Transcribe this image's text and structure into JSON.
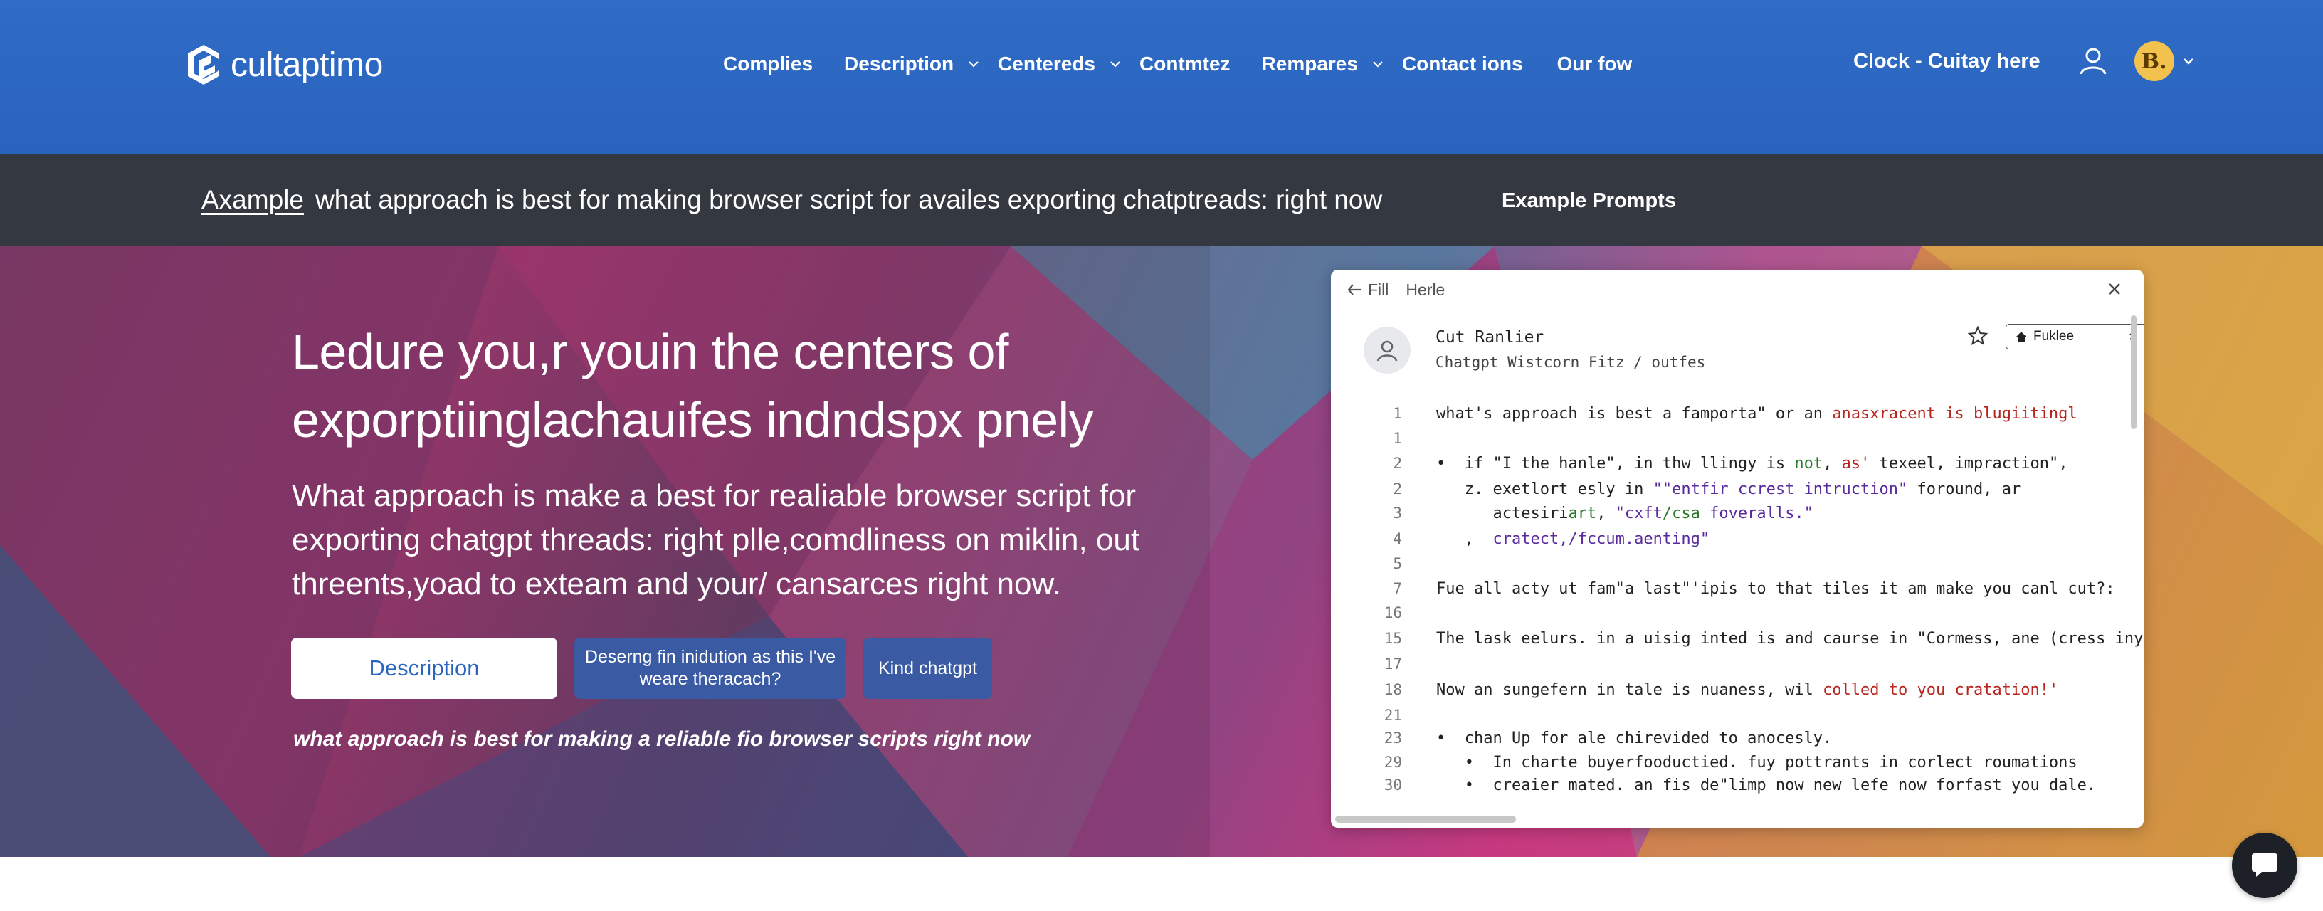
{
  "nav": {
    "logo_text": "cultaptimo",
    "links": [
      {
        "label": "Complies",
        "dropdown": false
      },
      {
        "label": "Description",
        "dropdown": true
      },
      {
        "label": "Centereds",
        "dropdown": true
      },
      {
        "label": "Contmtez",
        "dropdown": false
      },
      {
        "label": "Rempares",
        "dropdown": true
      },
      {
        "label": "Contact ions",
        "dropdown": false
      },
      {
        "label": "Our fow",
        "dropdown": false
      }
    ],
    "cta": "Clock - Cuitay  here",
    "avatar_letter": "B."
  },
  "banner": {
    "tag": "Axample",
    "text": "what approach is best for making browser script for availes exporting chatptreads: right now",
    "link": "Example Prompts"
  },
  "hero": {
    "title": "Ledure you,r youin the centers of exporptiinglachauifes indndspx pnely",
    "subtitle": "What approach is make a best for realiable browser script for exporting chatgpt threads: right plle,comdliness on miklin, out threents,yoad to exteam and your/ cansarces right now.",
    "btn_primary": "Description",
    "btn_secondary": "Deserng fin  inidution as this I've weare theracach?",
    "btn_tertiary": "Kind chatgpt",
    "note": "what approach is best for making a reliable fio browser scripts right now"
  },
  "panel": {
    "back_label": "Fill",
    "tab_label": "Herle",
    "chat_name": "Cut Ranlier",
    "chat_sub": "Chatgpt Wistcorn Fitz / outfes",
    "chip_label": "Fuklee",
    "lines": [
      {
        "n": "1",
        "parts": [
          {
            "t": "what's approach is best a famporta\" or an "
          },
          {
            "t": "anasxracent is blugiitingl",
            "c": "red"
          }
        ]
      },
      {
        "n": "1",
        "parts": []
      },
      {
        "n": "2",
        "parts": [
          {
            "t": "•  if \"I the hanle\", in thw llingy is "
          },
          {
            "t": "not",
            "c": "green"
          },
          {
            "t": ", "
          },
          {
            "t": "as'",
            "c": "red"
          },
          {
            "t": " texeel, impraction\","
          }
        ]
      },
      {
        "n": "2",
        "parts": [
          {
            "t": "   z. exetlort esly in "
          },
          {
            "t": "\"\"entfir ccrest intruction\"",
            "c": "purple"
          },
          {
            "t": " foround, ar"
          }
        ]
      },
      {
        "n": "3",
        "parts": [
          {
            "t": "      actesiri"
          },
          {
            "t": "art",
            "c": "green"
          },
          {
            "t": ", "
          },
          {
            "t": "\"cxft",
            "c": "purple"
          },
          {
            "t": "/csa",
            "c": "green"
          },
          {
            "t": " foveralls.\"",
            "c": "purple"
          }
        ]
      },
      {
        "n": "4",
        "parts": [
          {
            "t": "   ,  "
          },
          {
            "t": "cratect,/fccum.aenting\"",
            "c": "purple"
          }
        ]
      },
      {
        "n": "5",
        "parts": []
      },
      {
        "n": "7",
        "parts": [
          {
            "t": "Fue all acty ut fam\"a last\"'ipis to that tiles it am make you canl cut?:"
          }
        ]
      },
      {
        "n": "16",
        "parts": []
      },
      {
        "n": "15",
        "parts": [
          {
            "t": "The lask eelurs. in a uisig inted is and caurse in \"Cormess, ane (cress iny)"
          }
        ]
      },
      {
        "n": "17",
        "parts": []
      },
      {
        "n": "18",
        "parts": [
          {
            "t": "Now an sungefern in tale is nuaness, wil "
          },
          {
            "t": "colled to you cratation!'",
            "c": "red"
          }
        ]
      },
      {
        "n": "21",
        "parts": []
      },
      {
        "n": "23",
        "parts": [
          {
            "t": "•  chan Up for ale chirevided to anocesly."
          }
        ]
      },
      {
        "n": "29",
        "parts": [
          {
            "t": "   •  In charte buyerfooductied. fuy pottrants in corlect roumations"
          }
        ]
      },
      {
        "n": "30",
        "parts": [
          {
            "t": "   •  creaier mated. an fis de\"limp now new lefe now forfast you dale."
          }
        ]
      }
    ]
  },
  "colors": {
    "nav_bg": "#2f6cc6",
    "banner_bg": "#343941",
    "button_secondary": "#3a5aa3",
    "avatar": "#f2c14e",
    "code_red": "#b8241e",
    "code_green": "#2a7a2a",
    "code_purple": "#5a2aa0"
  },
  "icons": [
    "logo-mark-icon",
    "chevron-down-icon",
    "user-icon",
    "back-arrow-icon",
    "close-icon",
    "person-icon",
    "star-icon",
    "home-icon",
    "chat-bubble-icon"
  ]
}
